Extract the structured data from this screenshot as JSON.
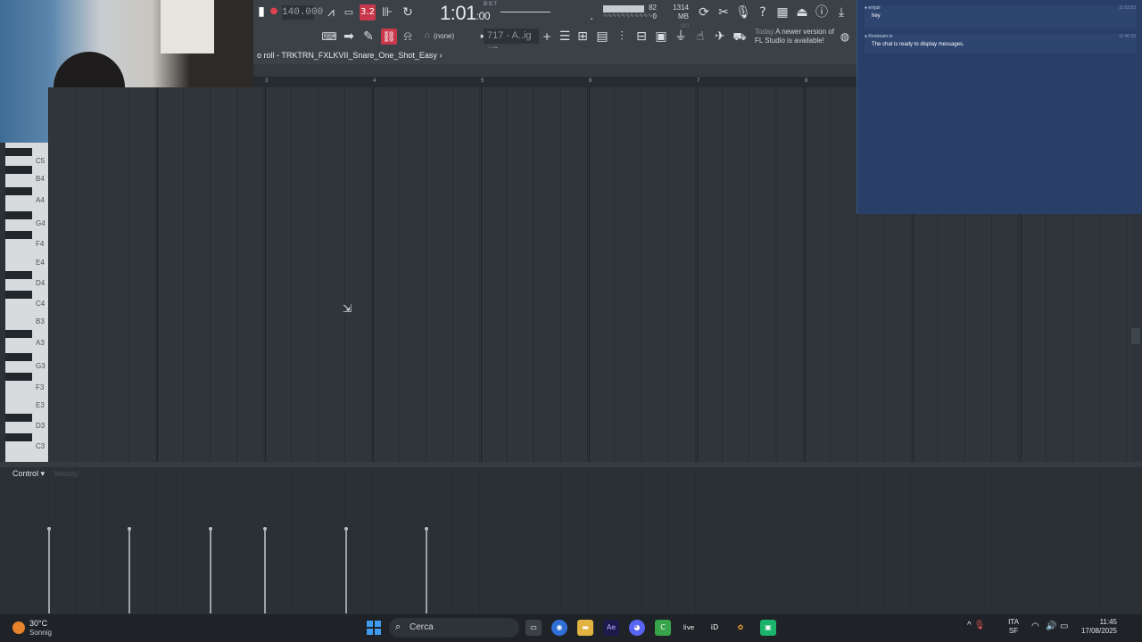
{
  "toolbar": {
    "tempo": "140.000",
    "time_main": "1:01",
    "time_sub": ":00",
    "bst_label": "B:S:T",
    "cpu_value": "82",
    "cpu_sub": "0",
    "memory": "1314 MB",
    "pattern_label": "717 - A..ig #2",
    "none_label": "(none)",
    "news_today": "Today",
    "news_text": "A newer version of FL Studio is available!",
    "record_label": "3.2"
  },
  "breadcrumb": "o roll - TRKTRN_FXLKVII_Snare_One_Shot_Easy",
  "ruler": [
    "3",
    "4",
    "5",
    "6",
    "7",
    "8"
  ],
  "piano": {
    "notes": [
      "C5",
      "B4",
      "A4",
      "G4",
      "F4",
      "E4",
      "D4",
      "C4",
      "B3",
      "A3",
      "G3",
      "F3",
      "E3",
      "D3",
      "C3"
    ]
  },
  "control": {
    "label": "Control",
    "sub_label": "Velocity"
  },
  "chat": {
    "messages": [
      {
        "user": "emjuli",
        "text": "hey",
        "time": "11:03:53"
      },
      {
        "user": "Restream.io",
        "text": "The chat is ready to display messages.",
        "time": "11:40:33"
      }
    ]
  },
  "taskbar": {
    "weather_temp": "30°C",
    "weather_desc": "Sonnig",
    "search_placeholder": "Cerca",
    "lang_top": "ITA",
    "lang_bottom": "SF",
    "time": "11:45",
    "date": "17/08/2025",
    "apps": [
      "task-view",
      "chrome",
      "file-explorer",
      "after-effects",
      "discord",
      "camtasia",
      "live",
      "id",
      "fl-studio",
      "app"
    ]
  },
  "colors": {
    "accent_red": "#c8374a",
    "chat_bg": "#2a3f67",
    "grid_bg": "#2f363b"
  }
}
